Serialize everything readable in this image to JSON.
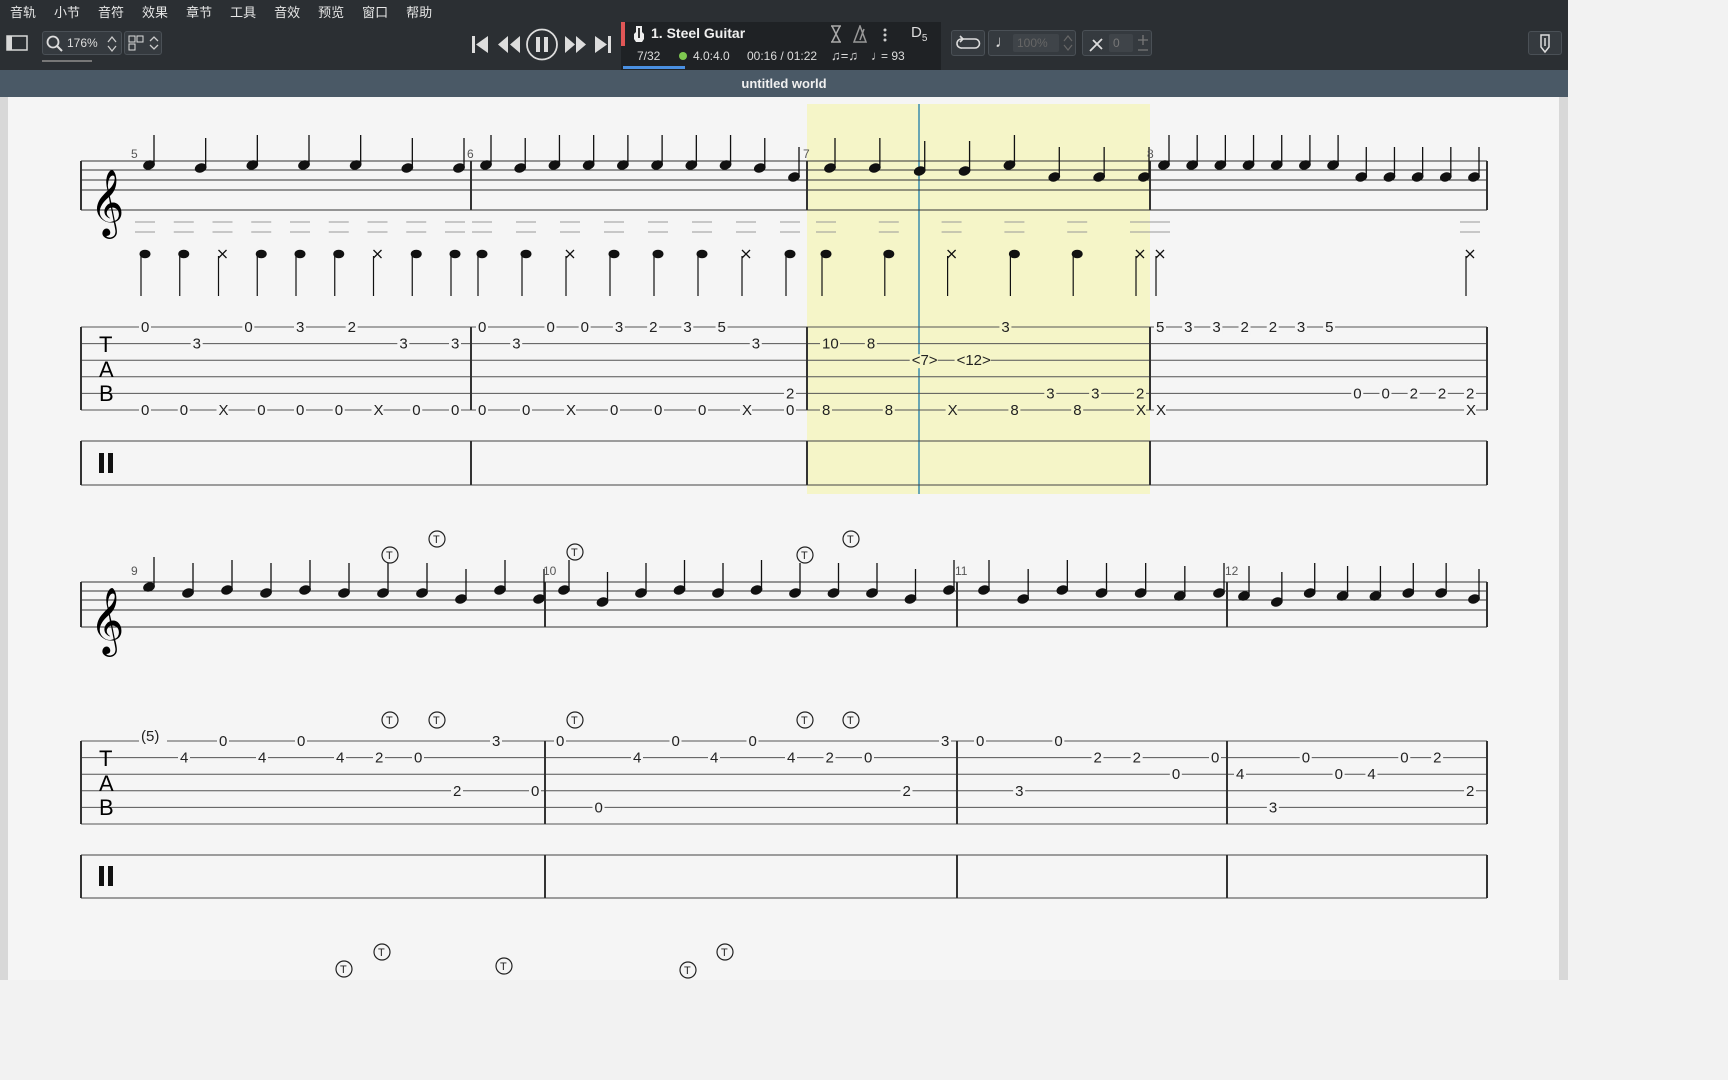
{
  "menu": [
    "音轨",
    "小节",
    "音符",
    "效果",
    "章节",
    "工具",
    "音效",
    "预览",
    "窗口",
    "帮助"
  ],
  "toolbar": {
    "zoom": "176%",
    "volume": "100%",
    "pan": "0"
  },
  "track": {
    "name": "1. Steel Guitar",
    "bar_position": "7/32",
    "time_signature": "4.0:4.0",
    "time": "00:16 / 01:22",
    "tempo_label": "= 93",
    "key": "D",
    "key_sub": "5"
  },
  "document": {
    "title": "untitled world"
  },
  "score": {
    "rows": [
      {
        "bars": [
          {
            "number": "5",
            "tab": [
              {
                "s": 1,
                "f": "0"
              },
              {
                "s": 2,
                "f": "3"
              },
              {
                "s": 1,
                "f": "0"
              },
              {
                "s": 1,
                "f": "3"
              },
              {
                "s": 1,
                "f": "2"
              },
              {
                "s": 2,
                "f": "3"
              },
              {
                "s": 2,
                "f": "3"
              },
              {
                "s": 6,
                "f": "0"
              },
              {
                "s": 6,
                "f": "0"
              },
              {
                "s": 6,
                "f": "X"
              },
              {
                "s": 6,
                "f": "0"
              },
              {
                "s": 6,
                "f": "0"
              },
              {
                "s": 6,
                "f": "0"
              },
              {
                "s": 6,
                "f": "X"
              },
              {
                "s": 6,
                "f": "0"
              },
              {
                "s": 6,
                "f": "0"
              }
            ]
          },
          {
            "number": "6",
            "tab": [
              {
                "s": 1,
                "f": "0"
              },
              {
                "s": 2,
                "f": "3"
              },
              {
                "s": 1,
                "f": "0"
              },
              {
                "s": 1,
                "f": "0"
              },
              {
                "s": 1,
                "f": "3"
              },
              {
                "s": 1,
                "f": "2"
              },
              {
                "s": 1,
                "f": "3"
              },
              {
                "s": 1,
                "f": "5"
              },
              {
                "s": 2,
                "f": "3"
              },
              {
                "s": 5,
                "f": "2"
              },
              {
                "s": 6,
                "f": "0"
              },
              {
                "s": 6,
                "f": "0"
              },
              {
                "s": 6,
                "f": "X"
              },
              {
                "s": 6,
                "f": "0"
              },
              {
                "s": 6,
                "f": "0"
              },
              {
                "s": 6,
                "f": "0"
              },
              {
                "s": 6,
                "f": "X"
              },
              {
                "s": 6,
                "f": "0"
              }
            ]
          },
          {
            "number": "7",
            "tab": [
              {
                "s": 2,
                "f": "10"
              },
              {
                "s": 2,
                "f": "8"
              },
              {
                "s": 3,
                "f": "<7>"
              },
              {
                "s": 3,
                "f": "<12>"
              },
              {
                "s": 1,
                "f": "3"
              },
              {
                "s": 6,
                "f": "8"
              },
              {
                "s": 6,
                "f": "8"
              },
              {
                "s": 6,
                "f": "X"
              },
              {
                "s": 6,
                "f": "8"
              },
              {
                "s": 6,
                "f": "8"
              },
              {
                "s": 5,
                "f": "3"
              },
              {
                "s": 6,
                "f": "X"
              },
              {
                "s": 5,
                "f": "3"
              },
              {
                "s": 5,
                "f": "2"
              }
            ]
          },
          {
            "number": "8",
            "tab": [
              {
                "s": 1,
                "f": "5"
              },
              {
                "s": 1,
                "f": "3"
              },
              {
                "s": 1,
                "f": "3"
              },
              {
                "s": 1,
                "f": "2"
              },
              {
                "s": 1,
                "f": "2"
              },
              {
                "s": 1,
                "f": "3"
              },
              {
                "s": 1,
                "f": "5"
              },
              {
                "s": 5,
                "f": "0"
              },
              {
                "s": 5,
                "f": "0"
              },
              {
                "s": 6,
                "f": "X"
              },
              {
                "s": 5,
                "f": "2"
              },
              {
                "s": 5,
                "f": "2"
              },
              {
                "s": 6,
                "f": "X"
              },
              {
                "s": 5,
                "f": "2"
              }
            ]
          }
        ]
      },
      {
        "bars": [
          {
            "number": "9",
            "tab": [
              {
                "s": 0,
                "f": "(5)"
              },
              {
                "s": 2,
                "f": "4"
              },
              {
                "s": 1,
                "f": "0"
              },
              {
                "s": 2,
                "f": "4"
              },
              {
                "s": 1,
                "f": "0"
              },
              {
                "s": 2,
                "f": "4"
              },
              {
                "s": 2,
                "f": "2"
              },
              {
                "s": 2,
                "f": "0"
              },
              {
                "s": 4,
                "f": "2"
              },
              {
                "s": 1,
                "f": "3"
              },
              {
                "s": 4,
                "f": "0"
              }
            ]
          },
          {
            "number": "10",
            "tab": [
              {
                "s": 1,
                "f": "0"
              },
              {
                "s": 5,
                "f": "0"
              },
              {
                "s": 2,
                "f": "4"
              },
              {
                "s": 1,
                "f": "0"
              },
              {
                "s": 2,
                "f": "4"
              },
              {
                "s": 1,
                "f": "0"
              },
              {
                "s": 2,
                "f": "4"
              },
              {
                "s": 2,
                "f": "2"
              },
              {
                "s": 2,
                "f": "0"
              },
              {
                "s": 4,
                "f": "2"
              },
              {
                "s": 1,
                "f": "3"
              }
            ]
          },
          {
            "number": "11",
            "tab": [
              {
                "s": 1,
                "f": "0"
              },
              {
                "s": 4,
                "f": "3"
              },
              {
                "s": 1,
                "f": "0"
              },
              {
                "s": 2,
                "f": "2"
              },
              {
                "s": 2,
                "f": "2"
              },
              {
                "s": 3,
                "f": "0"
              },
              {
                "s": 2,
                "f": "0"
              }
            ]
          },
          {
            "number": "12",
            "tab": [
              {
                "s": 3,
                "f": "4"
              },
              {
                "s": 5,
                "f": "3"
              },
              {
                "s": 2,
                "f": "0"
              },
              {
                "s": 3,
                "f": "0"
              },
              {
                "s": 3,
                "f": "4"
              },
              {
                "s": 2,
                "f": "0"
              },
              {
                "s": 2,
                "f": "2"
              },
              {
                "s": 4,
                "f": "2"
              }
            ]
          }
        ]
      }
    ],
    "tab_label": [
      "T",
      "A",
      "B"
    ],
    "tap_symbol": "T"
  },
  "colors": {
    "menubar": "#2b2f33",
    "page": "#f5f5f5",
    "selection": "#f5f5c8",
    "cursor": "#69a6b3",
    "accent": "#4a90e2"
  }
}
